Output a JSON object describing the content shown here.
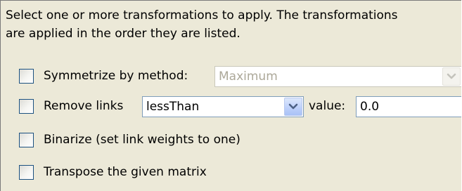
{
  "description": {
    "line1": "Select one or more transformations to apply. The transformations",
    "line2": "are applied in the order they are listed."
  },
  "options": {
    "symmetrize": {
      "checked": false,
      "label": "Symmetrize by method:",
      "method_selected": "Maximum",
      "method_enabled": false
    },
    "remove_links": {
      "checked": false,
      "label": "Remove links",
      "operator_selected": "lessThan",
      "value_label": "value:",
      "value": "0.0"
    },
    "binarize": {
      "checked": false,
      "label": "Binarize (set link weights to one)"
    },
    "transpose": {
      "checked": false,
      "label": "Transpose the given matrix"
    }
  },
  "icons": {
    "dropdown": "chevron-down-icon"
  }
}
